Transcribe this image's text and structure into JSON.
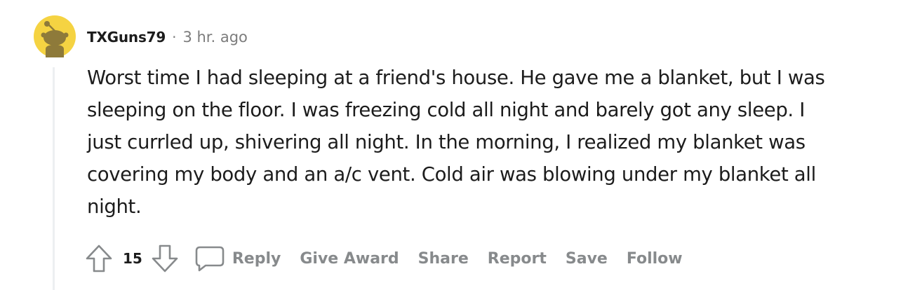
{
  "comment": {
    "author": "TXGuns79",
    "separator": "·",
    "timestamp": "3 hr. ago",
    "avatar_icon": "snoo-avatar-icon",
    "body_lines": [
      "Worst time I had sleeping at a friend's house. He gave me a blanket, but I was",
      "sleeping on the floor. I was freezing cold all night and barely got any sleep. I",
      "just currled up, shivering all night. In the morning, I realized my blanket was",
      "covering my body and an a/c vent. Cold air was blowing under my blanket all",
      "night."
    ],
    "score": "15"
  },
  "actions": {
    "upvote_icon": "upvote-arrow-icon",
    "downvote_icon": "downvote-arrow-icon",
    "reply_icon": "speech-bubble-icon",
    "reply": "Reply",
    "give_award": "Give Award",
    "share": "Share",
    "report": "Report",
    "save": "Save",
    "follow": "Follow"
  },
  "colors": {
    "avatar_bg": "#f5d342",
    "avatar_figure": "#8e7a3a",
    "text": "#1c1c1c",
    "meta": "#7c7c7c",
    "action": "#878a8c",
    "thread_line": "#edeff1"
  }
}
